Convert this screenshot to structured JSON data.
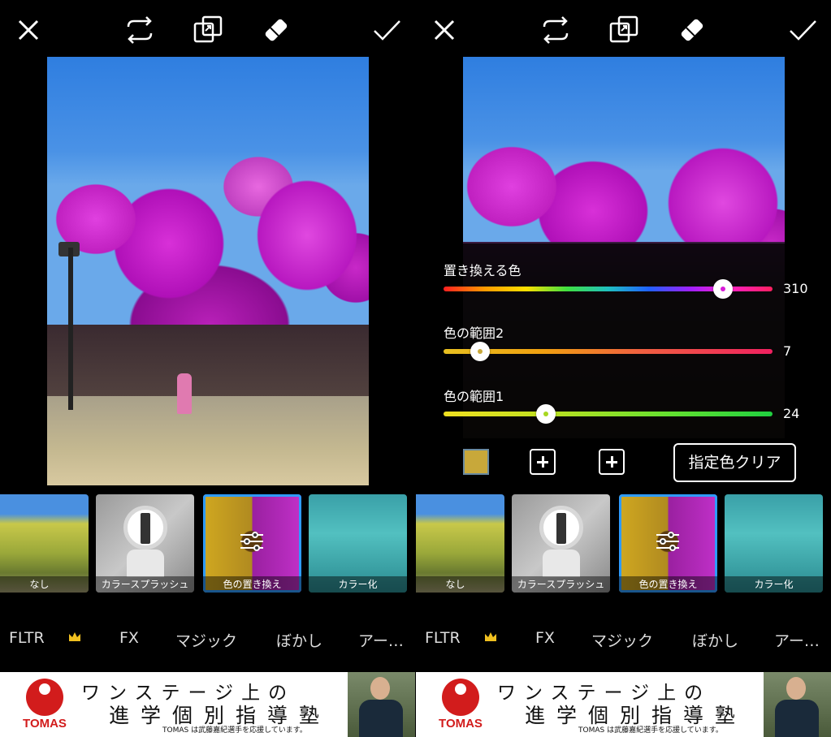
{
  "left": {
    "toolbar": {
      "close": "close-icon",
      "swap": "swap-icon",
      "compare": "compare-icon",
      "eraser": "eraser-icon",
      "apply": "check-icon"
    },
    "thumbnails": [
      {
        "label": "なし"
      },
      {
        "label": "カラースプラッシュ"
      },
      {
        "label": "色の置き換え",
        "selected": true
      },
      {
        "label": "カラー化"
      }
    ],
    "tabs": [
      "FLTR",
      "FX",
      "マジック",
      "ぼかし",
      "アー…"
    ],
    "ad": {
      "brand": "TOMAS",
      "line1": "ワンステージ上の",
      "line2": "進学個別指導塾",
      "line3": "TOMAS は武藤嘉紀選手を応援しています。"
    }
  },
  "right": {
    "toolbar": {
      "close": "close-icon",
      "swap": "swap-icon",
      "compare": "compare-icon",
      "eraser": "eraser-icon",
      "apply": "check-icon"
    },
    "sliders": [
      {
        "label": "置き換える色",
        "value": "310",
        "fraction": 0.85,
        "knob_dot": "#d81ad8"
      },
      {
        "label": "色の範囲2",
        "value": "7",
        "fraction": 0.11,
        "knob_dot": "#c8a83a"
      },
      {
        "label": "色の範囲1",
        "value": "24",
        "fraction": 0.31,
        "knob_dot": "#a8d820"
      }
    ],
    "swatch_color": "#c8a83a",
    "clear_button": "指定色クリア",
    "thumbnails": [
      {
        "label": "なし"
      },
      {
        "label": "カラースプラッシュ"
      },
      {
        "label": "色の置き換え",
        "selected": true
      },
      {
        "label": "カラー化"
      }
    ],
    "tabs": [
      "FLTR",
      "FX",
      "マジック",
      "ぼかし",
      "アー…"
    ],
    "ad": {
      "brand": "TOMAS",
      "line1": "ワンステージ上の",
      "line2": "進学個別指導塾",
      "line3": "TOMAS は武藤嘉紀選手を応援しています。"
    }
  },
  "colors": {
    "selected_border": "#2e9bff",
    "crown": "#f0c020"
  }
}
